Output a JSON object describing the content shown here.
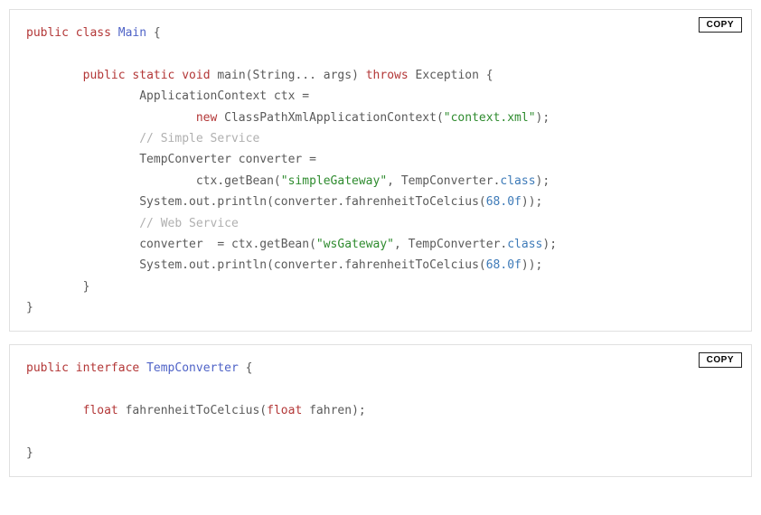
{
  "blocks": [
    {
      "copy_label": "COPY",
      "tokens": [
        {
          "cls": "kw",
          "t": "public"
        },
        {
          "cls": "plain",
          "t": " "
        },
        {
          "cls": "kw",
          "t": "class"
        },
        {
          "cls": "plain",
          "t": " "
        },
        {
          "cls": "type",
          "t": "Main"
        },
        {
          "cls": "plain",
          "t": " {\n\n"
        },
        {
          "cls": "plain",
          "t": "        "
        },
        {
          "cls": "kw",
          "t": "public"
        },
        {
          "cls": "plain",
          "t": " "
        },
        {
          "cls": "kw",
          "t": "static"
        },
        {
          "cls": "plain",
          "t": " "
        },
        {
          "cls": "kw",
          "t": "void"
        },
        {
          "cls": "plain",
          "t": " main(String... args) "
        },
        {
          "cls": "kw",
          "t": "throws"
        },
        {
          "cls": "plain",
          "t": " Exception {\n"
        },
        {
          "cls": "plain",
          "t": "                ApplicationContext ctx =\n"
        },
        {
          "cls": "plain",
          "t": "                        "
        },
        {
          "cls": "kw",
          "t": "new"
        },
        {
          "cls": "plain",
          "t": " ClassPathXmlApplicationContext("
        },
        {
          "cls": "str",
          "t": "\"context.xml\""
        },
        {
          "cls": "plain",
          "t": ");\n"
        },
        {
          "cls": "plain",
          "t": "                "
        },
        {
          "cls": "cmt",
          "t": "// Simple Service"
        },
        {
          "cls": "plain",
          "t": "\n"
        },
        {
          "cls": "plain",
          "t": "                TempConverter converter =\n"
        },
        {
          "cls": "plain",
          "t": "                        ctx.getBean("
        },
        {
          "cls": "str",
          "t": "\"simpleGateway\""
        },
        {
          "cls": "plain",
          "t": ", TempConverter."
        },
        {
          "cls": "prop",
          "t": "class"
        },
        {
          "cls": "plain",
          "t": ");\n"
        },
        {
          "cls": "plain",
          "t": "                System.out.println(converter.fahrenheitToCelcius("
        },
        {
          "cls": "num",
          "t": "68.0f"
        },
        {
          "cls": "plain",
          "t": "));\n"
        },
        {
          "cls": "plain",
          "t": "                "
        },
        {
          "cls": "cmt",
          "t": "// Web Service"
        },
        {
          "cls": "plain",
          "t": "\n"
        },
        {
          "cls": "plain",
          "t": "                converter  = ctx.getBean("
        },
        {
          "cls": "str",
          "t": "\"wsGateway\""
        },
        {
          "cls": "plain",
          "t": ", TempConverter."
        },
        {
          "cls": "prop",
          "t": "class"
        },
        {
          "cls": "plain",
          "t": ");\n"
        },
        {
          "cls": "plain",
          "t": "                System.out.println(converter.fahrenheitToCelcius("
        },
        {
          "cls": "num",
          "t": "68.0f"
        },
        {
          "cls": "plain",
          "t": "));\n"
        },
        {
          "cls": "plain",
          "t": "        }\n"
        },
        {
          "cls": "plain",
          "t": "}"
        }
      ]
    },
    {
      "copy_label": "COPY",
      "tokens": [
        {
          "cls": "kw",
          "t": "public"
        },
        {
          "cls": "plain",
          "t": " "
        },
        {
          "cls": "kw",
          "t": "interface"
        },
        {
          "cls": "plain",
          "t": " "
        },
        {
          "cls": "type",
          "t": "TempConverter"
        },
        {
          "cls": "plain",
          "t": " {\n\n"
        },
        {
          "cls": "plain",
          "t": "        "
        },
        {
          "cls": "kw",
          "t": "float"
        },
        {
          "cls": "plain",
          "t": " fahrenheitToCelcius("
        },
        {
          "cls": "kw",
          "t": "float"
        },
        {
          "cls": "plain",
          "t": " fahren);\n\n"
        },
        {
          "cls": "plain",
          "t": "}"
        }
      ]
    }
  ]
}
